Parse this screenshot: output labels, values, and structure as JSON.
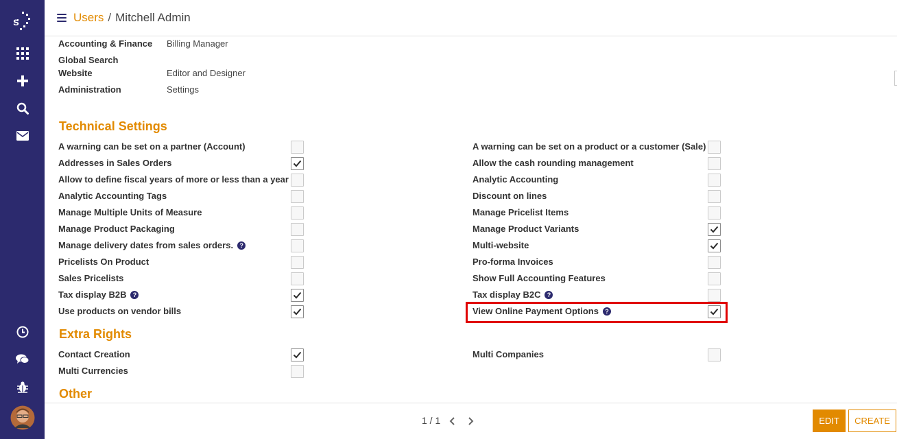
{
  "colors": {
    "sidebar": "#2c2a6e",
    "accent": "#e28a00",
    "highlight": "#e00000"
  },
  "sidebar": {
    "icons": [
      "logo-icon",
      "apps-icon",
      "plus-icon",
      "search-icon",
      "mail-icon",
      "clock-icon",
      "chat-icon",
      "bug-icon",
      "avatar"
    ]
  },
  "header": {
    "breadcrumb_parent": "Users",
    "breadcrumb_separator": "/",
    "breadcrumb_current": "Mitchell Admin"
  },
  "access_rights": [
    {
      "label": "Accounting & Finance",
      "value": "Billing Manager"
    },
    {
      "label": "Global Search",
      "value": ""
    },
    {
      "label": "Website",
      "value": "Editor and Designer"
    },
    {
      "label": "Administration",
      "value": "Settings"
    }
  ],
  "technical_settings": {
    "title": "Technical Settings",
    "left": [
      {
        "label": "A warning can be set on a partner (Account)",
        "checked": false,
        "help": false
      },
      {
        "label": "Addresses in Sales Orders",
        "checked": true,
        "help": false
      },
      {
        "label": "Allow to define fiscal years of more or less than a year",
        "checked": false,
        "help": false
      },
      {
        "label": "Analytic Accounting Tags",
        "checked": false,
        "help": false
      },
      {
        "label": "Manage Multiple Units of Measure",
        "checked": false,
        "help": false
      },
      {
        "label": "Manage Product Packaging",
        "checked": false,
        "help": false
      },
      {
        "label": "Manage delivery dates from sales orders.",
        "checked": false,
        "help": true
      },
      {
        "label": "Pricelists On Product",
        "checked": false,
        "help": false
      },
      {
        "label": "Sales Pricelists",
        "checked": false,
        "help": false
      },
      {
        "label": "Tax display B2B",
        "checked": true,
        "help": true
      },
      {
        "label": "Use products on vendor bills",
        "checked": true,
        "help": false
      }
    ],
    "right": [
      {
        "label": "A warning can be set on a product or a customer (Sale)",
        "checked": false,
        "help": false
      },
      {
        "label": "Allow the cash rounding management",
        "checked": false,
        "help": false
      },
      {
        "label": "Analytic Accounting",
        "checked": false,
        "help": false
      },
      {
        "label": "Discount on lines",
        "checked": false,
        "help": false
      },
      {
        "label": "Manage Pricelist Items",
        "checked": false,
        "help": false
      },
      {
        "label": "Manage Product Variants",
        "checked": true,
        "help": false
      },
      {
        "label": "Multi-website",
        "checked": true,
        "help": false
      },
      {
        "label": "Pro-forma Invoices",
        "checked": false,
        "help": false
      },
      {
        "label": "Show Full Accounting Features",
        "checked": false,
        "help": false
      },
      {
        "label": "Tax display B2C",
        "checked": false,
        "help": true
      },
      {
        "label": "View Online Payment Options",
        "checked": true,
        "help": true
      }
    ]
  },
  "extra_rights": {
    "title": "Extra Rights",
    "left": [
      {
        "label": "Contact Creation",
        "checked": true,
        "help": false
      },
      {
        "label": "Multi Currencies",
        "checked": false,
        "help": false
      }
    ],
    "right": [
      {
        "label": "Multi Companies",
        "checked": false,
        "help": false
      }
    ]
  },
  "other": {
    "title": "Other"
  },
  "help_glyph": "?",
  "footer": {
    "pager": "1 / 1",
    "edit_label": "EDIT",
    "create_label": "CREATE"
  }
}
